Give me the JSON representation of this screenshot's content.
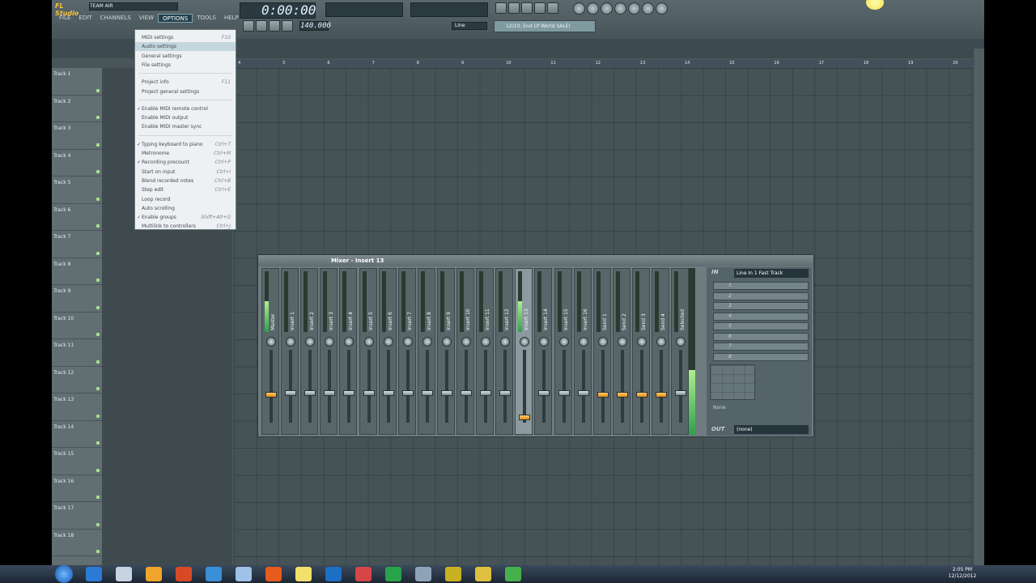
{
  "app": {
    "title": "FL Studio",
    "project_name": "TEAM AIR"
  },
  "menubar": [
    "FILE",
    "EDIT",
    "CHANNELS",
    "VIEW",
    "OPTIONS",
    "TOOLS",
    "HELP"
  ],
  "active_menu": "OPTIONS",
  "transport": {
    "time": "0:00:00",
    "tempo": "140.000",
    "snap": "Line",
    "hint": "12/10: End Of World SALE!"
  },
  "options_menu": {
    "items": [
      {
        "label": "MIDI settings",
        "shortcut": "F10"
      },
      {
        "label": "Audio settings",
        "shortcut": "",
        "highlighted": true
      },
      {
        "label": "General settings",
        "shortcut": ""
      },
      {
        "label": "File settings",
        "shortcut": ""
      },
      {
        "label": "Project info",
        "shortcut": "F11"
      },
      {
        "label": "Project general settings",
        "shortcut": ""
      },
      {
        "label": "Enable MIDI remote control",
        "shortcut": "",
        "checked": true
      },
      {
        "label": "Enable MIDI output",
        "shortcut": ""
      },
      {
        "label": "Enable MIDI master sync",
        "shortcut": ""
      },
      {
        "label": "Typing keyboard to piano",
        "shortcut": "Ctrl+T",
        "checked": true
      },
      {
        "label": "Metronome",
        "shortcut": "Ctrl+M"
      },
      {
        "label": "Recording precount",
        "shortcut": "Ctrl+P",
        "checked": true
      },
      {
        "label": "Start on input",
        "shortcut": "Ctrl+I"
      },
      {
        "label": "Blend recorded notes",
        "shortcut": "Ctrl+B"
      },
      {
        "label": "Step edit",
        "shortcut": "Ctrl+E"
      },
      {
        "label": "Loop record",
        "shortcut": ""
      },
      {
        "label": "Auto scrolling",
        "shortcut": ""
      },
      {
        "label": "Enable groups",
        "shortcut": "Shift+Alt+G",
        "checked": true
      },
      {
        "label": "Multilink to controllers",
        "shortcut": "Ctrl+J"
      }
    ]
  },
  "playlist": {
    "tracks": [
      "Track 1",
      "Track 2",
      "Track 3",
      "Track 4",
      "Track 5",
      "Track 6",
      "Track 7",
      "Track 8",
      "Track 9",
      "Track 10",
      "Track 11",
      "Track 12",
      "Track 13",
      "Track 14",
      "Track 15",
      "Track 16",
      "Track 17",
      "Track 18"
    ],
    "ruler": [
      "4",
      "5",
      "6",
      "7",
      "8",
      "9",
      "10",
      "11",
      "12",
      "13",
      "14",
      "15",
      "16",
      "17",
      "18",
      "19",
      "20"
    ]
  },
  "mixer": {
    "title": "Mixer - Insert 13",
    "strips": [
      "Master",
      "Insert 1",
      "Insert 2",
      "Insert 3",
      "Insert 4",
      "Insert 5",
      "Insert 6",
      "Insert 7",
      "Insert 8",
      "Insert 9",
      "Insert 10",
      "Insert 11",
      "Insert 12",
      "Insert 13",
      "Insert 14",
      "Insert 15",
      "Insert 16",
      "Send 1",
      "Send 2",
      "Send 3",
      "Send 4",
      "Selected"
    ],
    "input_label": "IN",
    "input": "Line In 1 Fast Track",
    "fx_slots": [
      "1",
      "2",
      "3",
      "4",
      "5",
      "6",
      "7",
      "8"
    ],
    "eq_label": "None",
    "output_label": "OUT",
    "output": "(none)"
  },
  "taskbar": {
    "time": "2:05 PM",
    "date": "12/12/2012"
  }
}
